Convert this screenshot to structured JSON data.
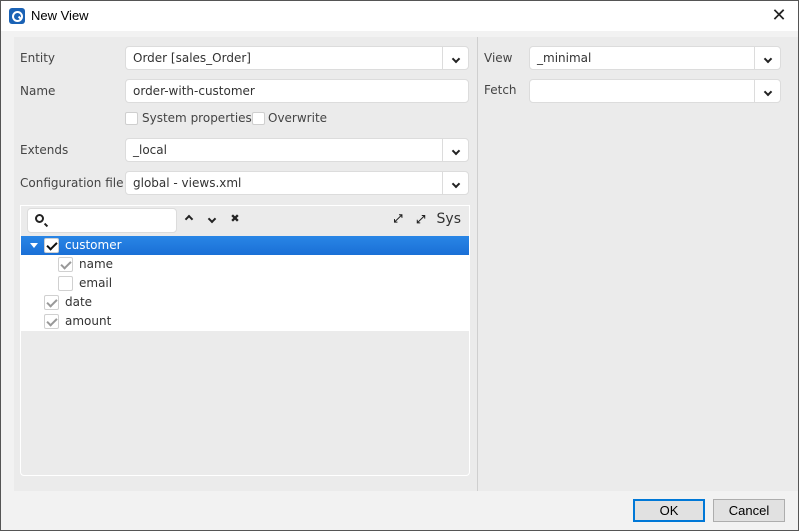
{
  "window": {
    "title": "New View",
    "close_icon": "close-icon",
    "app_icon": "app-logo-icon"
  },
  "form": {
    "entity": {
      "label": "Entity",
      "value": "Order [sales_Order]"
    },
    "name": {
      "label": "Name",
      "value": "order-with-customer"
    },
    "system_properties": {
      "label": "System properties",
      "checked": false
    },
    "overwrite": {
      "label": "Overwrite",
      "checked": false
    },
    "extends": {
      "label": "Extends",
      "value": "_local"
    },
    "config_file": {
      "label": "Configuration file",
      "value": "global - views.xml"
    }
  },
  "tree_toolbar": {
    "search_placeholder": "",
    "move_up": "chevron-up-icon",
    "move_down": "chevron-down-icon",
    "clear": "clear-icon",
    "expand": "expand-icon",
    "collapse": "collapse-icon",
    "sys_label": "Sys"
  },
  "tree": {
    "items": [
      {
        "label": "customer",
        "checked": true,
        "selected": true,
        "expanded": true,
        "level": 0
      },
      {
        "label": "name",
        "checked": true,
        "selected": false,
        "level": 1
      },
      {
        "label": "email",
        "checked": false,
        "selected": false,
        "level": 1
      },
      {
        "label": "date",
        "checked": true,
        "selected": false,
        "level": 0
      },
      {
        "label": "amount",
        "checked": true,
        "selected": false,
        "level": 0
      }
    ]
  },
  "right": {
    "view": {
      "label": "View",
      "value": "_minimal"
    },
    "fetch": {
      "label": "Fetch",
      "value": ""
    }
  },
  "footer": {
    "ok_label": "OK",
    "cancel_label": "Cancel"
  },
  "colors": {
    "selection": "#1a6fd6",
    "default_button_border": "#0078d7"
  }
}
